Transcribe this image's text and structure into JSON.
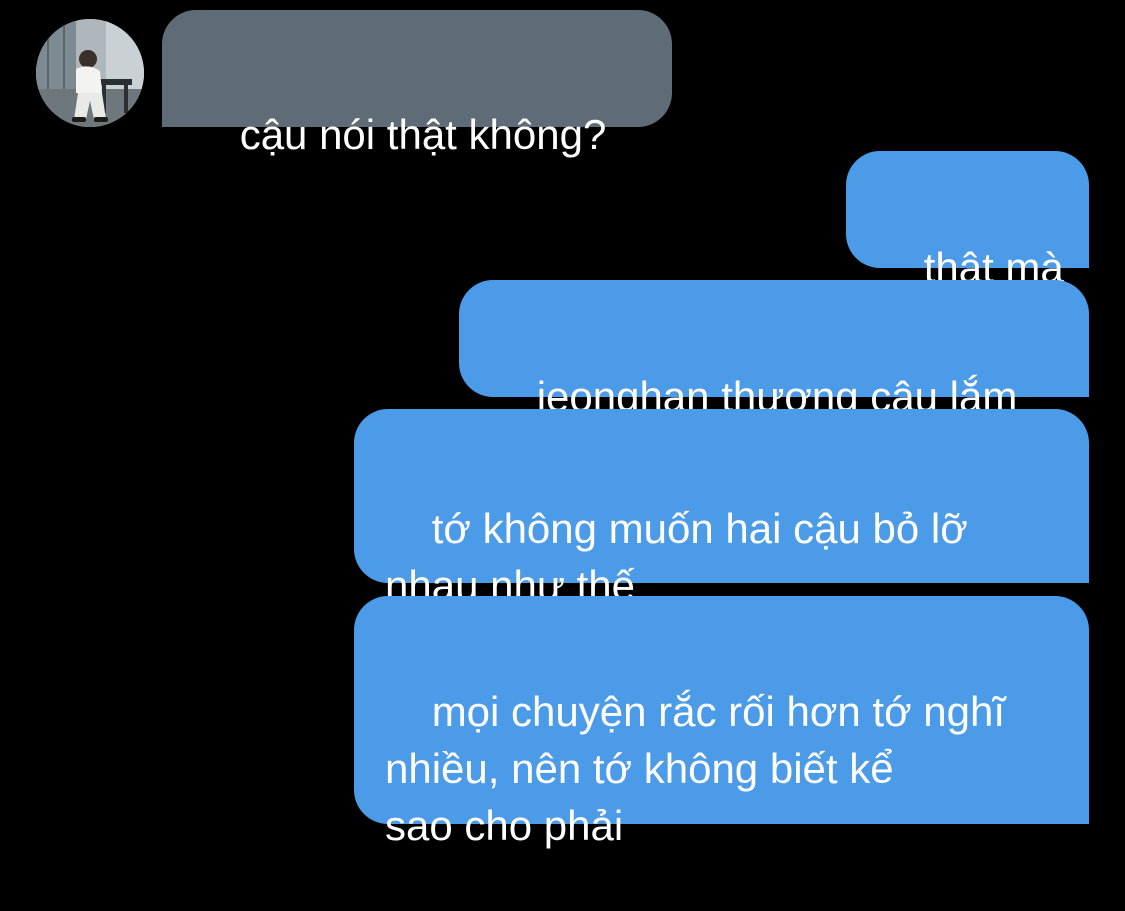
{
  "theme": {
    "background": "#000000",
    "incoming_bubble": "#5f6b76",
    "outgoing_bubble": "#4c9be8",
    "text_color": "#ffffff"
  },
  "contact": {
    "avatar": "person-photo-avatar"
  },
  "messages": [
    {
      "direction": "incoming",
      "text": "cậu nói thật không?"
    },
    {
      "direction": "outgoing",
      "text": "thật mà"
    },
    {
      "direction": "outgoing",
      "text": "jeonghan thương cậu lắm"
    },
    {
      "direction": "outgoing",
      "text": "tớ không muốn hai cậu bỏ lỡ\nnhau như thế"
    },
    {
      "direction": "outgoing",
      "text": "mọi chuyện rắc rối hơn tớ nghĩ\nnhiều, nên tớ không biết kể\nsao cho phải"
    }
  ]
}
